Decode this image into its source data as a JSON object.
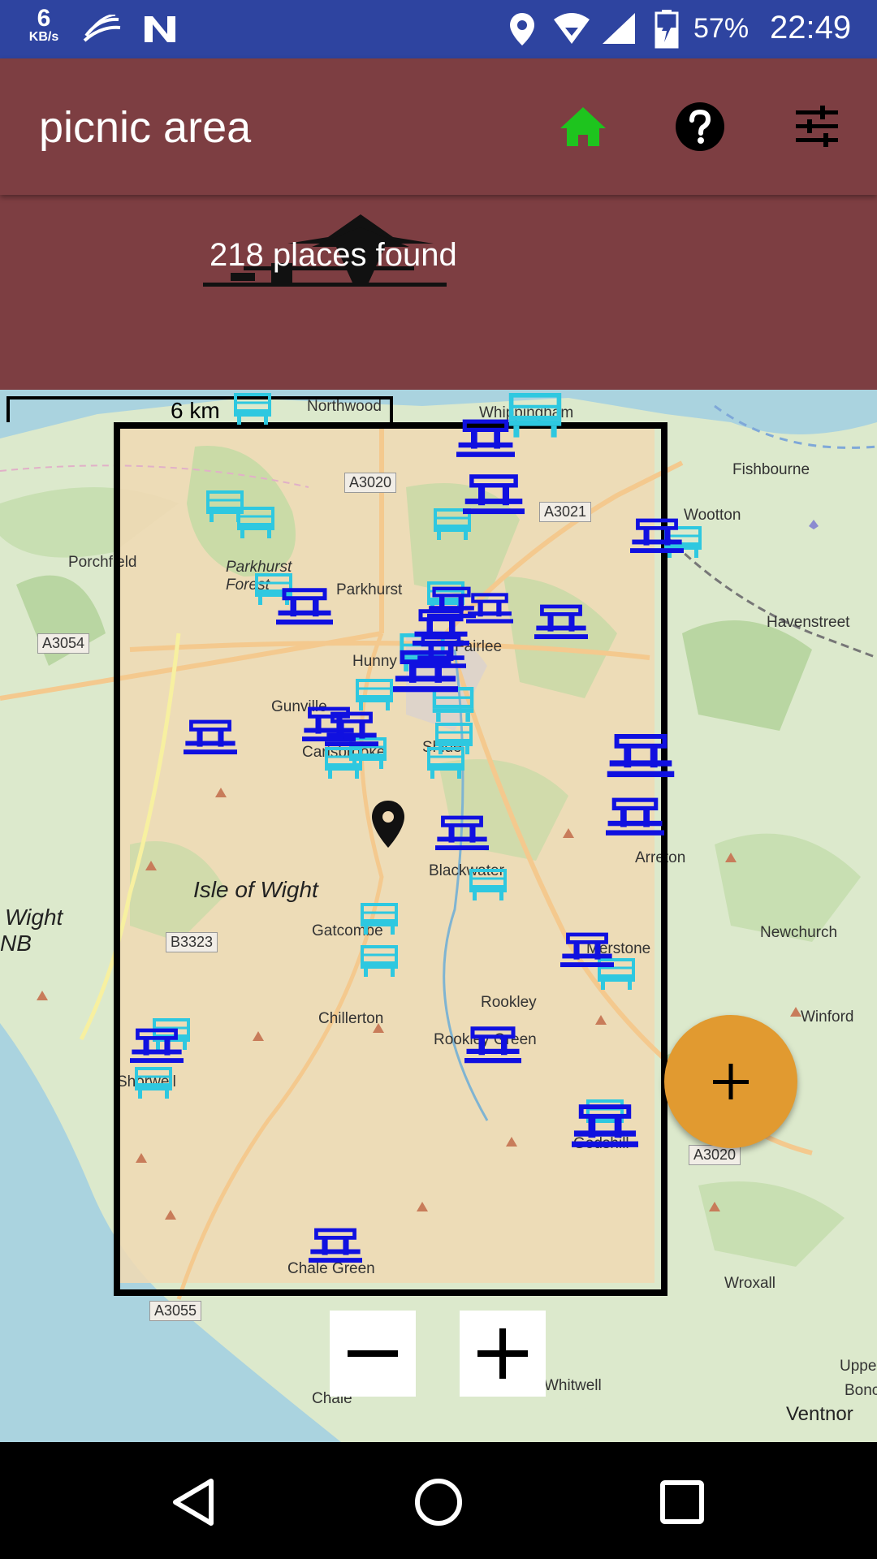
{
  "status_bar": {
    "net_speed_value": "6",
    "net_speed_unit": "KB/s",
    "icons": [
      "swiftkey-icon",
      "n-notification-icon",
      "location-icon",
      "wifi-icon",
      "signal-icon",
      "battery-charging-icon"
    ],
    "battery": "57%",
    "time": "22:49"
  },
  "app_bar": {
    "title": "picnic area",
    "home_color": "#1EC41E",
    "icons": [
      "home-icon",
      "help-icon",
      "filter-icon"
    ]
  },
  "header": {
    "places_found": "218 places found",
    "logo": "pagoda-logo"
  },
  "map": {
    "scale_label": "6 km",
    "labels": {
      "northwood": "Northwood",
      "whippingham": "Whippingham",
      "fishbourne": "Fishbourne",
      "wootton": "Wootton",
      "porchfield": "Porchfield",
      "parkhurst_forest": "Parkhurst Forest",
      "parkhurst": "Parkhurst",
      "havenstreet": "Havenstreet",
      "hunny_hill": "Hunny",
      "fairlee": "Fairlee",
      "gunville": "Gunville",
      "carisbrooke": "Carisbrooke",
      "shide": "Shide",
      "blackwater": "Blackwater",
      "arreton": "Arreton",
      "isle_of_wight": "Isle of Wight",
      "wight_aonb": "Wight",
      "nb": "NB",
      "gatcombe": "Gatcombe",
      "newchurch": "Newchurch",
      "merstone": "Merstone",
      "rookley": "Rookley",
      "rookley_green": "Rookley Green",
      "chillerton": "Chillerton",
      "winford": "Winford",
      "shorwell": "Shorwell",
      "godshill": "Godshill",
      "chale_green": "Chale Green",
      "wroxall": "Wroxall",
      "chale": "Chale",
      "whitwell": "Whitwell",
      "upper": "Uppe",
      "bonchurch": "Bonc",
      "ventnor": "Ventnor"
    },
    "roads": {
      "a3020_north": "A3020",
      "a3021": "A3021",
      "a3054": "A3054",
      "b3323": "B3323",
      "a3020_south": "A3020",
      "a3055": "A3055"
    },
    "marker_colors": {
      "picnic_table": "#1010E0",
      "bench": "#2EC8E0"
    }
  },
  "controls": {
    "zoom_out_icon": "minus-icon",
    "zoom_in_icon": "plus-icon",
    "fab_icon": "add-icon",
    "fab_color": "#E19A30"
  },
  "nav_bar": {
    "icons": [
      "back-icon",
      "home-circle-icon",
      "recents-icon"
    ]
  }
}
